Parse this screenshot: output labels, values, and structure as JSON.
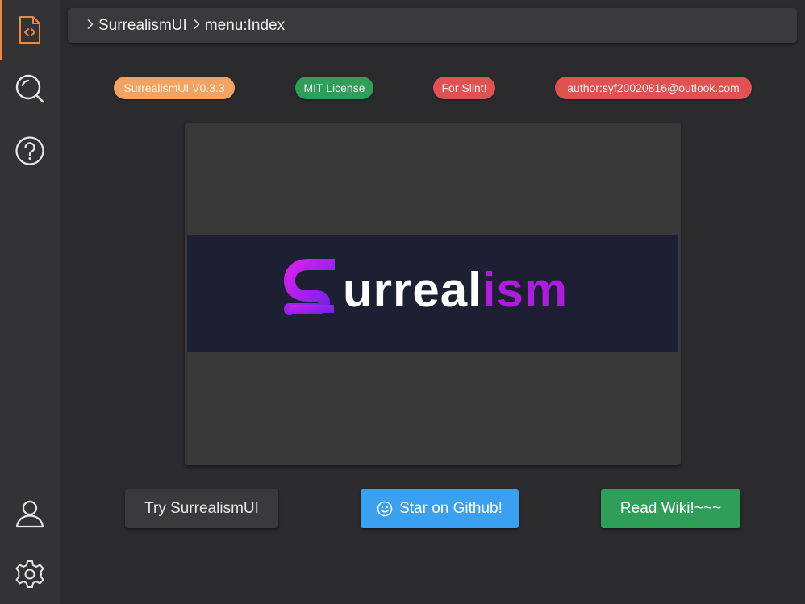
{
  "breadcrumb": [
    {
      "label": "SurrealismUI"
    },
    {
      "label": "menu:Index"
    }
  ],
  "sidebar": {
    "top": [
      {
        "icon": "code-file-icon",
        "active": true
      },
      {
        "icon": "search-icon",
        "active": false
      },
      {
        "icon": "help-icon",
        "active": false
      }
    ],
    "bottom": [
      {
        "icon": "user-icon"
      },
      {
        "icon": "settings-icon"
      }
    ]
  },
  "tags": {
    "version": "SurrealismUI V0.3.3",
    "license": "MIT License",
    "slint": "For Slint!",
    "author": "author:syf20020816@outlook.com"
  },
  "logo": {
    "text_white": "urreal",
    "text_purple": "ism"
  },
  "buttons": {
    "try": "Try SurrealismUI",
    "star": "Star on Github!",
    "wiki": "Read Wiki!~~~"
  },
  "colors": {
    "accent_orange": "#f0883e",
    "tag_orange": "#f4a261",
    "green": "#2f9e59",
    "red": "#e05151",
    "blue": "#3aa0ef",
    "logo_purple": "#b01be0",
    "logo_bg": "#1c2032"
  }
}
